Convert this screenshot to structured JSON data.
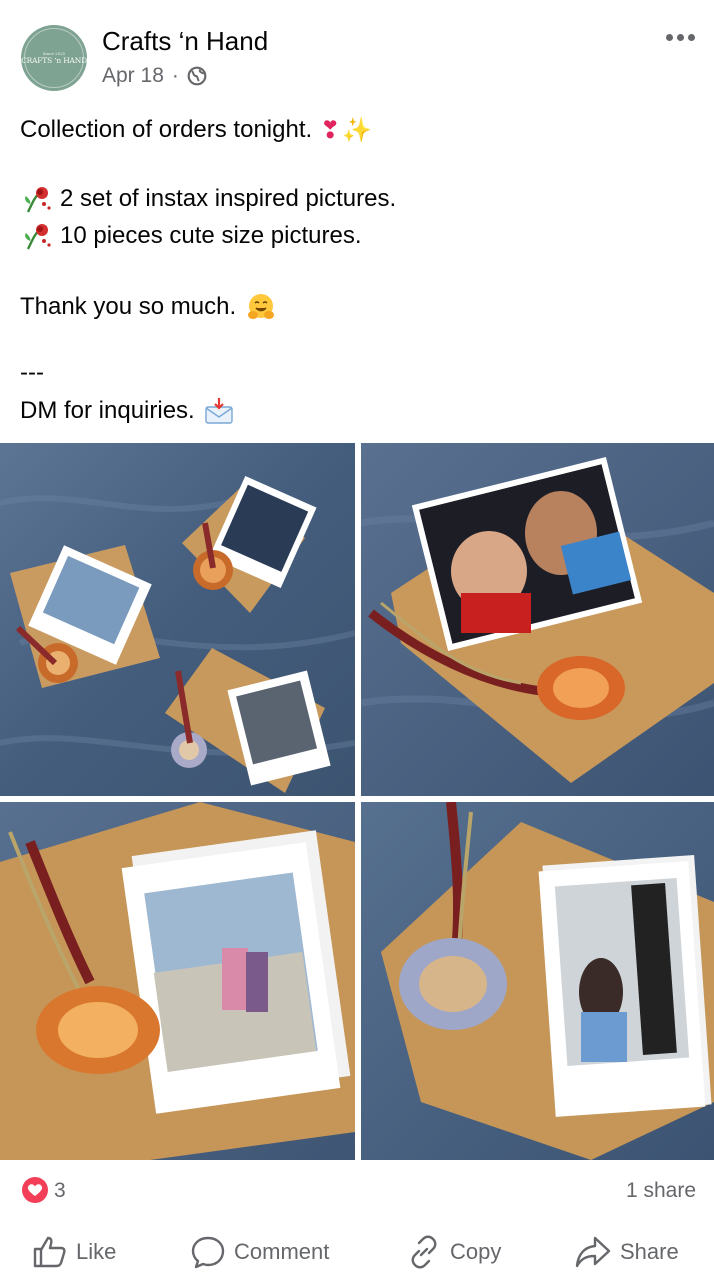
{
  "post": {
    "author": "Crafts ‘n Hand",
    "avatar_text": "CRAFTS ‘n HAND",
    "avatar_top_text": "Since 2021",
    "date": "Apr 18",
    "separator": "·",
    "audience_icon": "globe-icon",
    "more_icon": "more-dots-icon",
    "lines": {
      "line1": "Collection of orders tonight.",
      "line2": "2 set of instax inspired pictures.",
      "line3": "10 pieces cute size pictures.",
      "line4": "Thank you so much.",
      "line5": "---",
      "line6": "DM for inquiries."
    },
    "emojis": {
      "line1": "❣️✨",
      "bullet": "🥀",
      "line4": "🤗",
      "line6": "📩"
    }
  },
  "photos": [
    {
      "name": "photo-grid-1"
    },
    {
      "name": "photo-grid-2"
    },
    {
      "name": "photo-grid-3"
    },
    {
      "name": "photo-grid-4"
    }
  ],
  "stats": {
    "reaction_count": "3",
    "shares": "1 share"
  },
  "actions": {
    "like": "Like",
    "comment": "Comment",
    "copy": "Copy",
    "share": "Share"
  },
  "colors": {
    "text": "#050505",
    "secondary": "#65676b",
    "love": "#f33e58",
    "avatar": "#7fa393"
  }
}
